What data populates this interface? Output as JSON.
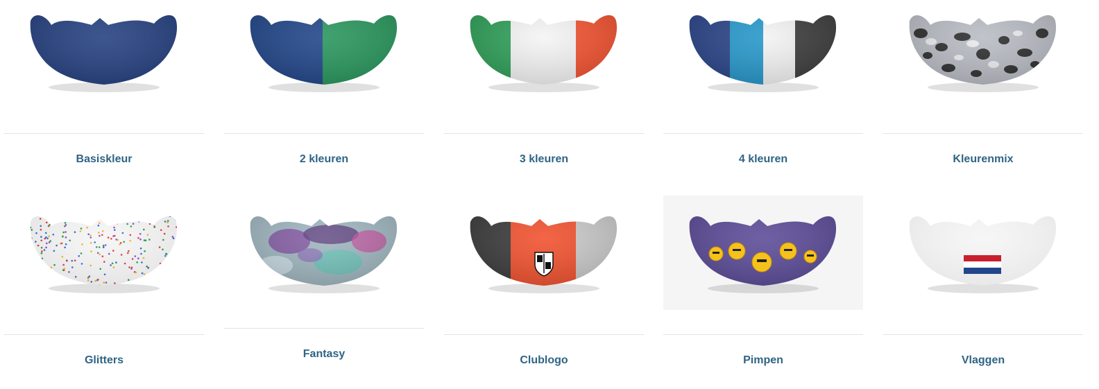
{
  "products": [
    {
      "label": "Basiskleur",
      "icon": "mouthguard-solid-blue-icon",
      "colors": [
        "#233f7f"
      ]
    },
    {
      "label": "2 kleuren",
      "icon": "mouthguard-two-color-icon",
      "colors": [
        "#1f4488",
        "#27955b"
      ]
    },
    {
      "label": "3 kleuren",
      "icon": "mouthguard-three-color-icon",
      "colors": [
        "#2d9f57",
        "#f4f4f4",
        "#f1502d"
      ]
    },
    {
      "label": "4 kleuren",
      "icon": "mouthguard-four-color-icon",
      "colors": [
        "#284287",
        "#2496c9",
        "#f3f3f3",
        "#3a3a3a"
      ]
    },
    {
      "label": "Kleurenmix",
      "icon": "mouthguard-colormix-icon",
      "colors": [
        "#b8bcc3",
        "#2c2c2c"
      ]
    },
    {
      "label": "Glitters",
      "icon": "mouthguard-glitter-icon",
      "colors": [
        "#f6f6f6"
      ]
    },
    {
      "label": "Fantasy",
      "icon": "mouthguard-fantasy-icon",
      "colors": [
        "#9fb6c0",
        "#7e4a9e",
        "#67c4b6",
        "#c44f9e"
      ]
    },
    {
      "label": "Clublogo",
      "icon": "mouthguard-clublogo-icon",
      "colors": [
        "#3a3a3a",
        "#f1502d",
        "#c9c9c9"
      ]
    },
    {
      "label": "Pimpen",
      "icon": "mouthguard-pimpen-suns-icon",
      "colors": [
        "#5a4a97",
        "#f5c21c"
      ]
    },
    {
      "label": "Vlaggen",
      "icon": "mouthguard-dutch-flag-icon",
      "colors": [
        "#f6f6f6",
        "#c8202c",
        "#ffffff",
        "#21468b"
      ]
    }
  ]
}
